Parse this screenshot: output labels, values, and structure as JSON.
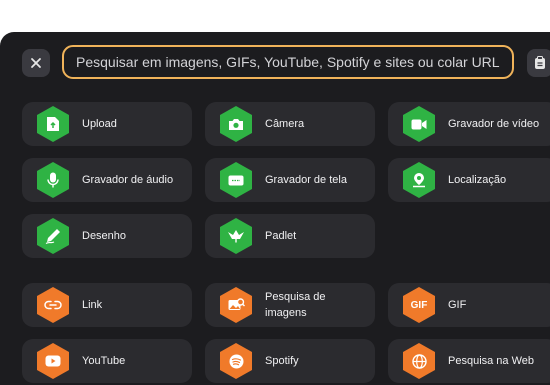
{
  "search": {
    "placeholder": "Pesquisar em imagens, GIFs, YouTube, Spotify e sites ou colar URL"
  },
  "colors": {
    "accent_border": "#f0b35a",
    "green": "#2fb344",
    "orange": "#f07a2a",
    "panel": "#1c1c1f",
    "tile": "#2b2b2f"
  },
  "tiles": {
    "upload": "Upload",
    "camera": "Câmera",
    "video_recorder": "Gravador de vídeo",
    "audio_recorder": "Gravador de áudio",
    "screen_recorder": "Gravador de tela",
    "location": "Localização",
    "drawing": "Desenho",
    "padlet": "Padlet",
    "link": "Link",
    "image_search_line1": "Pesquisa de",
    "image_search_line2": "imagens",
    "gif": "GIF",
    "youtube": "YouTube",
    "spotify": "Spotify",
    "web_search": "Pesquisa na Web"
  },
  "icons": {
    "close": "close-icon",
    "clipboard": "clipboard-icon",
    "upload": "file-upload-icon",
    "camera": "camera-icon",
    "video": "video-camera-icon",
    "audio": "microphone-icon",
    "screen": "screen-icon",
    "location": "map-pin-icon",
    "drawing": "pen-icon",
    "padlet": "padlet-leaf-icon",
    "link": "link-icon",
    "image_search": "image-search-icon",
    "gif_badge": "GIF",
    "youtube": "youtube-icon",
    "spotify": "spotify-icon",
    "web": "globe-icon"
  }
}
